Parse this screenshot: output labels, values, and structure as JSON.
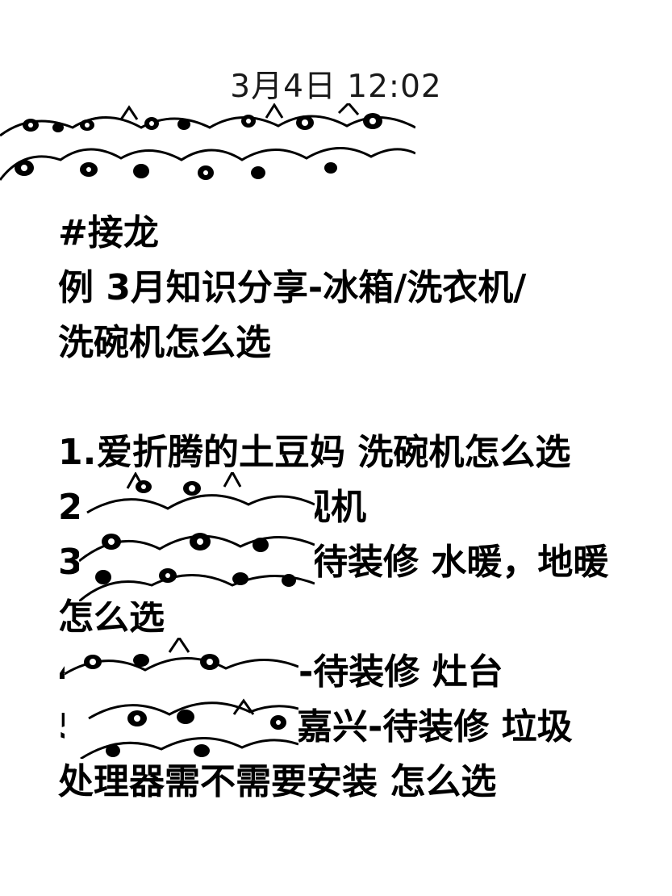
{
  "header": {
    "timestamp": "3月4日 12:02"
  },
  "message": {
    "tag": "#接龙",
    "example_line1": "例 3月知识分享-冰箱/洗衣机/",
    "example_line2": "洗碗机怎么选",
    "entries": [
      {
        "number": "1.",
        "text": "爱折腾的土豆妈 洗碗机怎么选"
      },
      {
        "number": "2.",
        "text": "电视机"
      },
      {
        "number": "3.",
        "text": "待装修 水暖，地暖"
      },
      {
        "number": "",
        "text": "怎么选"
      },
      {
        "number": "4",
        "text": "上海-待装修  灶台"
      },
      {
        "number": "5.",
        "text": "嘉兴-待装修 垃圾"
      },
      {
        "number": "",
        "text": "处理器需不需要安装 怎么选"
      }
    ]
  },
  "stickers": {
    "icon": "cartoon-face-doodle-pattern"
  }
}
